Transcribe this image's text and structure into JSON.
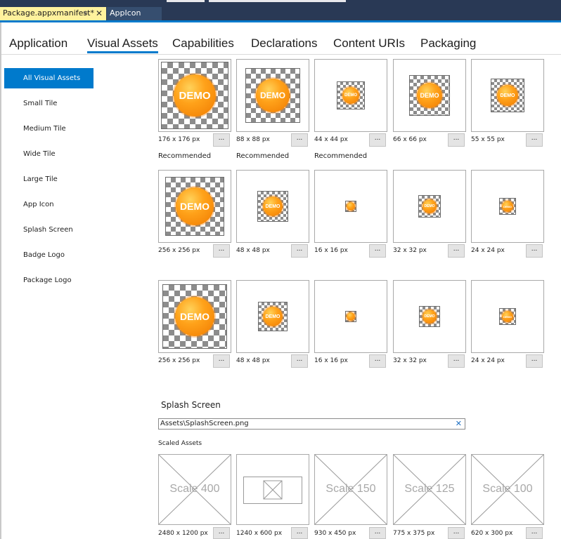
{
  "document_tabs": [
    {
      "label": "Package.appxmanifest*",
      "active": true
    },
    {
      "label": "AppIcon",
      "active": false
    }
  ],
  "manifest_tabs": [
    "Application",
    "Visual Assets",
    "Capabilities",
    "Declarations",
    "Content URIs",
    "Packaging"
  ],
  "selected_manifest_tab": "Visual Assets",
  "sidebar": {
    "items": [
      "All Visual Assets",
      "Small Tile",
      "Medium Tile",
      "Wide Tile",
      "Large Tile",
      "App Icon",
      "Splash Screen",
      "Badge Logo",
      "Package Logo"
    ],
    "selected": "All Visual Assets"
  },
  "browse_label": "...",
  "badge_text": "DEMO",
  "asset_rows": [
    {
      "sizes": [
        "176 x 176 px",
        "88 x 88 px",
        "44 x 44 px",
        "66 x 66 px",
        "55 x 55 px"
      ],
      "recommended": [
        "Recommended",
        "Recommended",
        "Recommended",
        "",
        ""
      ]
    },
    {
      "sizes": [
        "256 x 256 px",
        "48 x 48 px",
        "16 x 16 px",
        "32 x 32 px",
        "24 x 24 px"
      ],
      "recommended": []
    },
    {
      "sizes": [
        "256 x 256 px",
        "48 x 48 px",
        "16 x 16 px",
        "32 x 32 px",
        "24 x 24 px"
      ],
      "recommended": []
    }
  ],
  "splash_screen": {
    "heading": "Splash Screen",
    "path": "Assets\\SplashScreen.png",
    "scaled_label": "Scaled Assets",
    "assets": [
      {
        "scale": "Scale 400",
        "size": "2480 x 1200 px"
      },
      {
        "scale": "",
        "size": "1240 x 600 px"
      },
      {
        "scale": "Scale 150",
        "size": "930 x 450 px"
      },
      {
        "scale": "Scale 125",
        "size": "775 x 375 px"
      },
      {
        "scale": "Scale 100",
        "size": "620 x 300 px"
      }
    ]
  },
  "colors": {
    "accent": "#007acc",
    "active_tab": "#fff29d",
    "title_bar": "#293955",
    "badge": "#ffa21a"
  }
}
